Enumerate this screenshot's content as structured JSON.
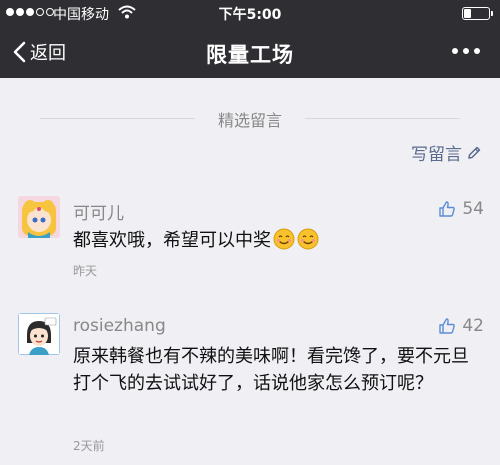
{
  "status": {
    "carrier": "中国移动",
    "time": "下午5:00"
  },
  "nav": {
    "back_label": "返回",
    "title": "限量工场"
  },
  "section": {
    "label": "精选留言",
    "write_label": "写留言"
  },
  "comments": [
    {
      "name": "可可儿",
      "likes": "54",
      "content": "都喜欢哦，希望可以中奖",
      "time": "昨天",
      "emoji": [
        "smile-emoji",
        "smile-emoji"
      ]
    },
    {
      "name": "rosiezhang",
      "likes": "42",
      "content": "原来韩餐也有不辣的美味啊！看完馋了，要不元旦打个飞的去试试好了，话说他家怎么预订呢？",
      "time": "2天前"
    }
  ],
  "colors": {
    "bar": "#2e2e33",
    "background": "#efeff4",
    "link": "#5b6b8c"
  }
}
